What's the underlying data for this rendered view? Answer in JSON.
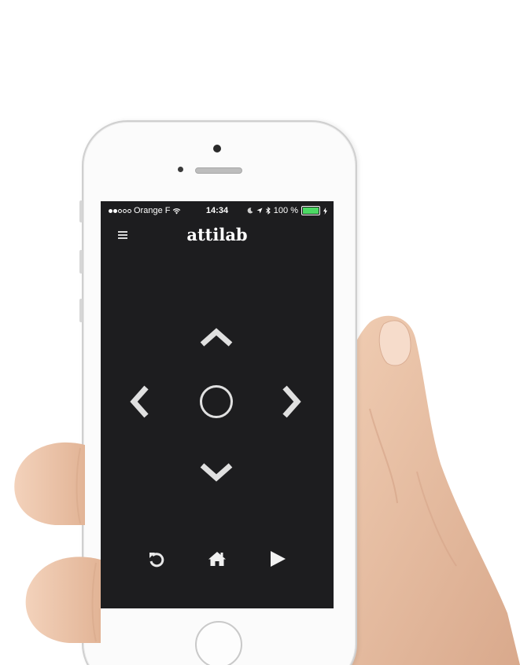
{
  "status_bar": {
    "carrier": "Orange F",
    "time": "14:34",
    "battery_text": "100 %",
    "battery_level": 1.0,
    "battery_color": "#4cd964"
  },
  "header": {
    "title": "attilab",
    "menu_icon": "hamburger-menu-icon"
  },
  "dpad": {
    "up_icon": "chevron-up-icon",
    "down_icon": "chevron-down-icon",
    "left_icon": "chevron-left-icon",
    "right_icon": "chevron-right-icon",
    "center_icon": "circle-select-icon"
  },
  "bottom_controls": {
    "back_icon": "undo-icon",
    "home_icon": "home-icon",
    "play_icon": "play-icon"
  },
  "colors": {
    "screen_background": "#1d1d1f",
    "control_color": "#e0e0e0",
    "phone_body": "#fbfbfb",
    "skin": "#eac3a8"
  }
}
